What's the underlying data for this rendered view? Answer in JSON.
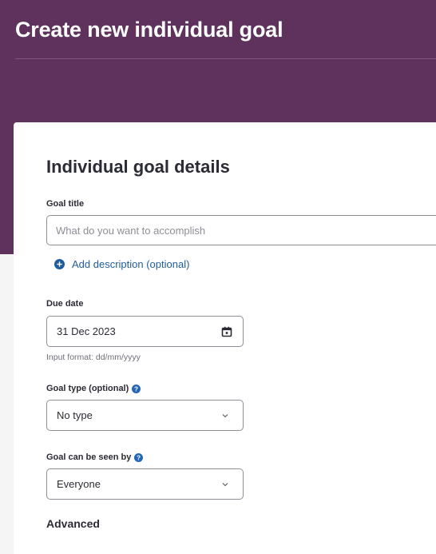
{
  "header": {
    "title": "Create new individual goal"
  },
  "form": {
    "section_title": "Individual goal details",
    "goal_title": {
      "label": "Goal title",
      "value": "",
      "placeholder": "What do you want to accomplish"
    },
    "add_description": {
      "label": "Add description (optional)",
      "icon": "plus-circle-icon"
    },
    "due_date": {
      "label": "Due date",
      "value": "31 Dec 2023",
      "hint": "Input format: dd/mm/yyyy",
      "icon": "calendar-icon"
    },
    "goal_type": {
      "label": "Goal type (optional)",
      "selected": "No type",
      "help_icon": "help-icon"
    },
    "visibility": {
      "label": "Goal can be seen by",
      "selected": "Everyone",
      "help_icon": "help-icon"
    },
    "advanced": {
      "label": "Advanced"
    }
  },
  "colors": {
    "header_bg": "#5e325d",
    "page_bg": "#f5f5f6",
    "card_bg": "#ffffff",
    "link": "#1f5c9e",
    "help_icon": "#2366b8",
    "text": "#2b2b35"
  }
}
